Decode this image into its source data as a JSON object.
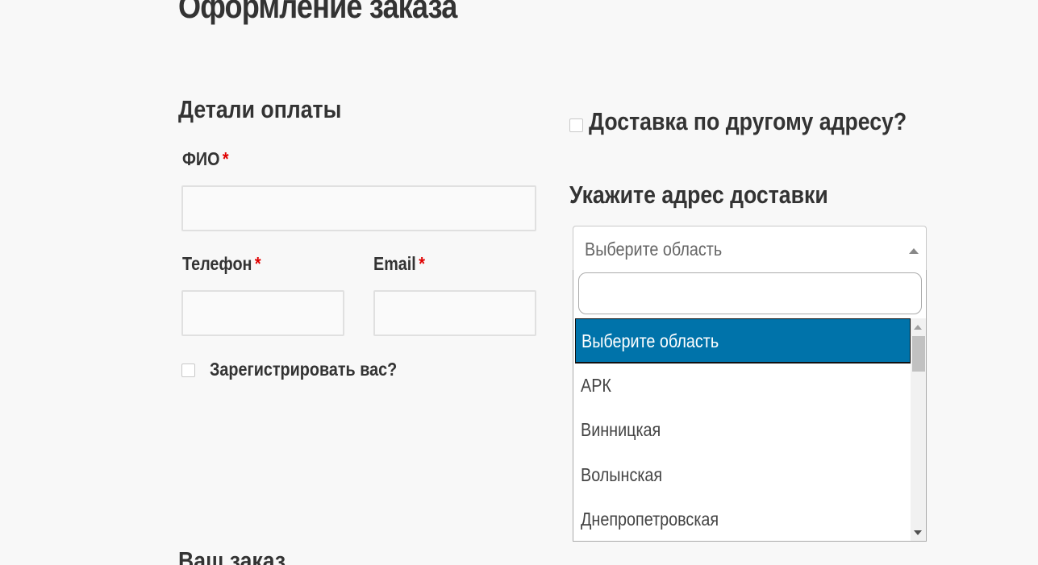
{
  "page_title": "Оформление заказа",
  "billing": {
    "heading": "Детали оплаты",
    "fio_label": "ФИО",
    "phone_label": "Телефон",
    "email_label": "Email",
    "required_mark": "*",
    "fio_value": "",
    "phone_value": "",
    "email_value": "",
    "register_label": "Зарегистрировать вас?"
  },
  "shipping": {
    "other_address_label": "Доставка по другому адресу?",
    "address_heading": "Укажите адрес доставки",
    "region_select": {
      "selected": "Выберите область",
      "search_value": "",
      "options": [
        "Выберите область",
        "АРК",
        "Винницкая",
        "Волынская",
        "Днепропетровская"
      ],
      "highlighted_index": 0
    }
  },
  "order": {
    "heading": "Ваш заказ"
  },
  "colors": {
    "highlight": "#0073aa",
    "required": "#e00000",
    "background": "#f8f8f8"
  }
}
